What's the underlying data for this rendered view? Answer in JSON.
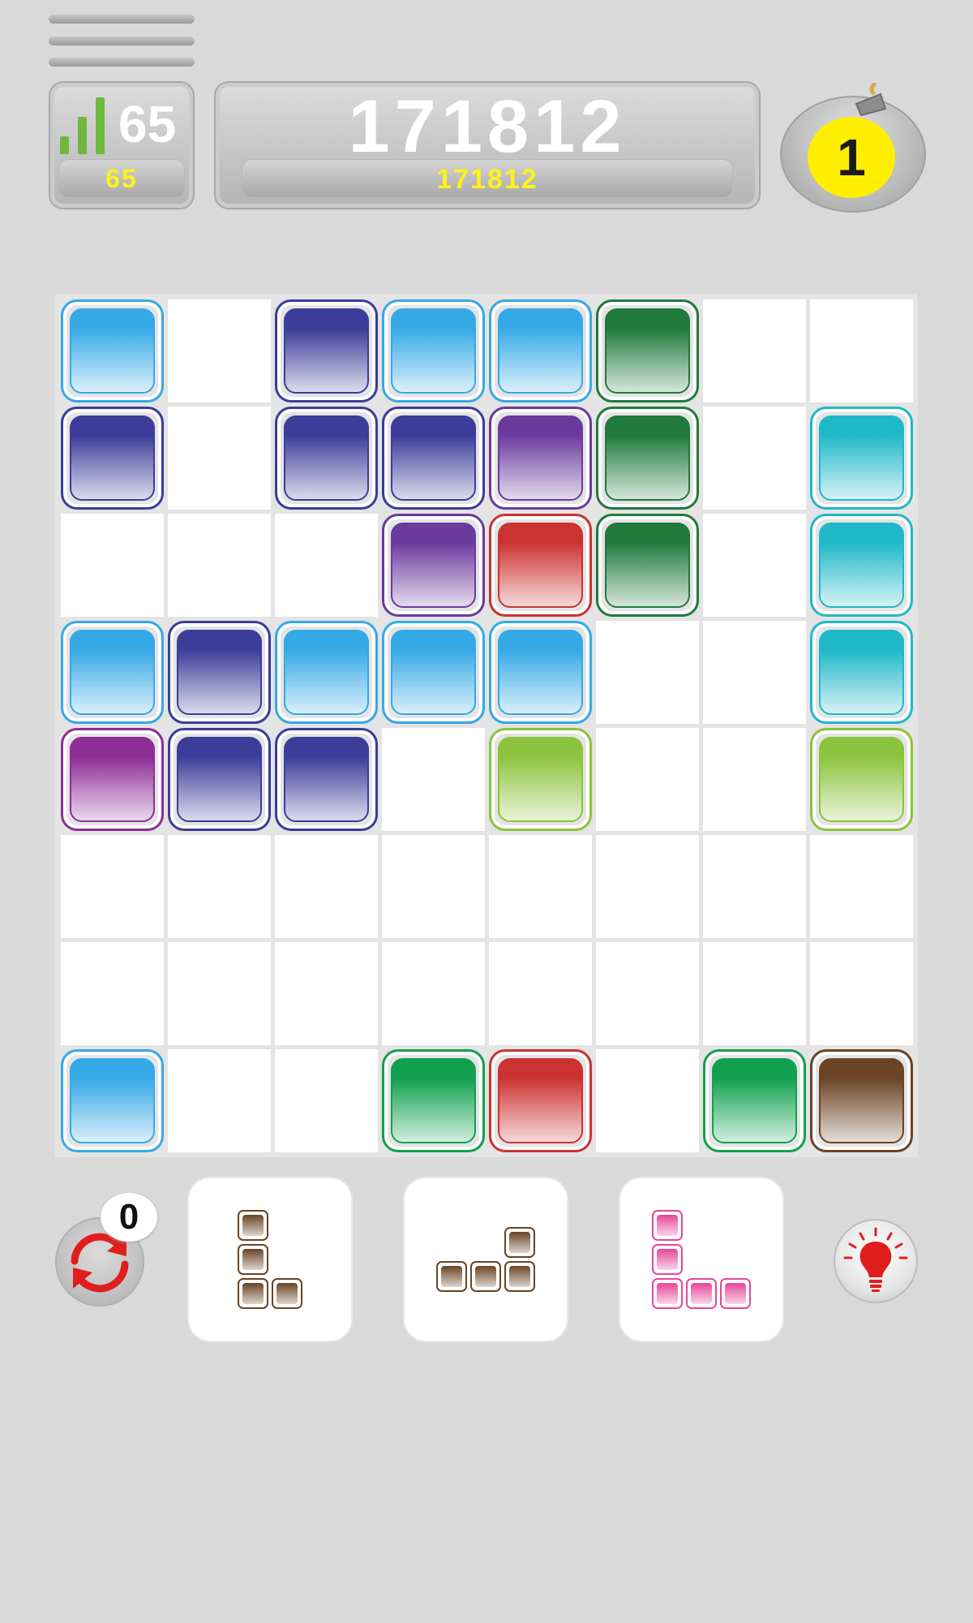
{
  "hud": {
    "level": "65",
    "level_sub": "65",
    "score": "171812",
    "score_sub": "171812",
    "bomb_count": "1",
    "rotate_count": "0"
  },
  "icons": {
    "menu": "hamburger-menu-icon",
    "level": "signal-bars-icon",
    "bomb": "bomb-icon",
    "rotate": "rotate-arrows-icon",
    "hint": "lightbulb-icon"
  },
  "colors": {
    "sky": "#35a9e6",
    "indigo": "#3c3c9a",
    "purple": "#6a3a9e",
    "magenta": "#8e2d96",
    "red": "#cc3232",
    "darkgreen": "#1f7a3c",
    "green": "#11a04e",
    "cyan": "#1fb8c9",
    "lime": "#8cc33c",
    "brown": "#6a4424",
    "pink": "#e6469a"
  },
  "board": {
    "size": 8,
    "grid": [
      [
        "sky",
        null,
        "indigo",
        "sky",
        "sky",
        "darkgreen",
        null,
        null
      ],
      [
        "indigo",
        null,
        "indigo",
        "indigo",
        "purple",
        "darkgreen",
        null,
        "cyan"
      ],
      [
        null,
        null,
        null,
        "purple",
        "red",
        "darkgreen",
        null,
        "cyan"
      ],
      [
        "sky",
        "indigo",
        "sky",
        "sky",
        "sky",
        null,
        null,
        "cyan"
      ],
      [
        "magenta",
        "indigo",
        "indigo",
        null,
        "lime",
        null,
        null,
        "lime"
      ],
      [
        null,
        null,
        null,
        null,
        null,
        null,
        null,
        null
      ],
      [
        null,
        null,
        null,
        null,
        null,
        null,
        null,
        null
      ],
      [
        "sky",
        null,
        null,
        "green",
        "red",
        null,
        "green",
        "brown"
      ]
    ]
  },
  "pieces": [
    {
      "color": "brown",
      "cells": [
        [
          0,
          0
        ],
        [
          1,
          0
        ],
        [
          2,
          0
        ],
        [
          2,
          1
        ]
      ]
    },
    {
      "color": "brown",
      "cells": [
        [
          0,
          2
        ],
        [
          1,
          0
        ],
        [
          1,
          1
        ],
        [
          1,
          2
        ]
      ]
    },
    {
      "color": "pink",
      "cells": [
        [
          0,
          0
        ],
        [
          1,
          0
        ],
        [
          2,
          0
        ],
        [
          2,
          1
        ],
        [
          2,
          2
        ]
      ]
    }
  ]
}
